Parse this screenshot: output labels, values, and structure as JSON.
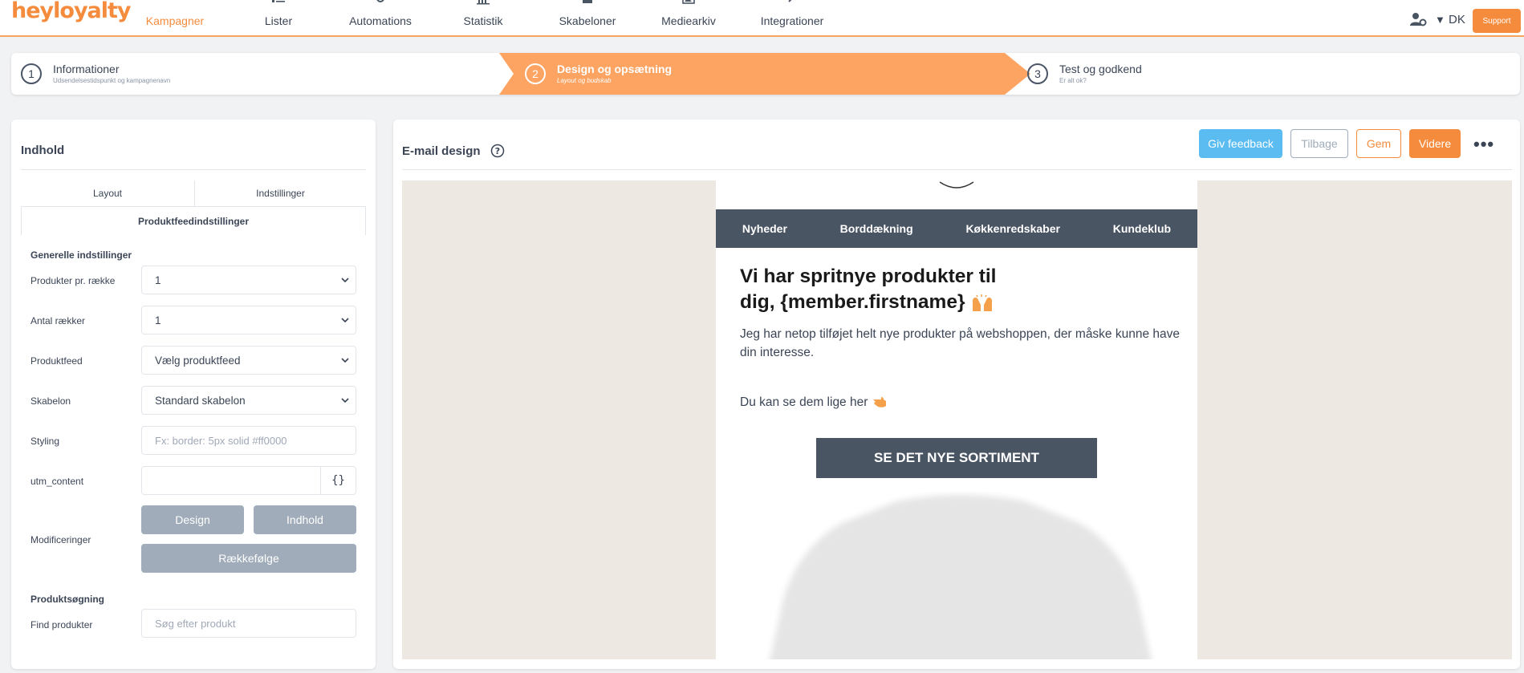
{
  "brand": {
    "logo_text": "heyloyalty",
    "accent": "#f58b3c",
    "dark": "#4a5564",
    "info": "#5bbcf2"
  },
  "nav": {
    "items": [
      {
        "label": "Kampagner",
        "icon": "megaphone-icon",
        "active": true
      },
      {
        "label": "Lister",
        "icon": "list-icon"
      },
      {
        "label": "Automations",
        "icon": "gears-icon"
      },
      {
        "label": "Statistik",
        "icon": "bar-chart-icon"
      },
      {
        "label": "Skabeloner",
        "icon": "template-icon"
      },
      {
        "label": "Mediearkiv",
        "icon": "images-icon"
      },
      {
        "label": "Integrationer",
        "icon": "plug-icon"
      }
    ],
    "language": "DK",
    "support_label": "Support"
  },
  "stepper": {
    "steps": [
      {
        "num": "1",
        "title": "Informationer",
        "sub": "Udsendelsestidspunkt og kampagnenavn"
      },
      {
        "num": "2",
        "title": "Design og opsætning",
        "sub": "Layout og budskab",
        "active": true
      },
      {
        "num": "3",
        "title": "Test og godkend",
        "sub": "Er alt ok?"
      }
    ]
  },
  "left": {
    "title": "Indhold",
    "tabs": {
      "layout": "Layout",
      "settings": "Indstillinger",
      "productfeed": "Produktfeedindstillinger"
    },
    "general_title": "Generelle indstillinger",
    "fields": {
      "per_row": {
        "label": "Produkter pr. række",
        "value": "1"
      },
      "rows": {
        "label": "Antal rækker",
        "value": "1"
      },
      "feed": {
        "label": "Produktfeed",
        "value": "Vælg produktfeed"
      },
      "template": {
        "label": "Skabelon",
        "value": "Standard skabelon"
      },
      "styling": {
        "label": "Styling",
        "placeholder": "Fx: border: 5px solid #ff0000"
      },
      "utm": {
        "label": "utm_content",
        "value": "",
        "btn": "{}"
      }
    },
    "modifications": {
      "label": "Modificeringer",
      "design": "Design",
      "content": "Indhold",
      "order": "Rækkefølge"
    },
    "search_title": "Produktsøgning",
    "search": {
      "label": "Find produkter",
      "placeholder": "Søg efter produkt"
    }
  },
  "right": {
    "title": "E-mail design",
    "buttons": {
      "feedback": "Giv feedback",
      "back": "Tilbage",
      "save": "Gem",
      "next": "Videre"
    },
    "email": {
      "menu": [
        "Nyheder",
        "Borddækning",
        "Køkkenredskaber",
        "Kundeklub"
      ],
      "heading_line1": "Vi har spritnye produkter til",
      "heading_line2": "dig, {member.firstname}",
      "body": "Jeg har netop tilføjet helt nye produkter på webshoppen, der måske kunne have din interesse.",
      "body2": "Du kan se dem lige her",
      "cta": "SE DET NYE SORTIMENT"
    }
  }
}
